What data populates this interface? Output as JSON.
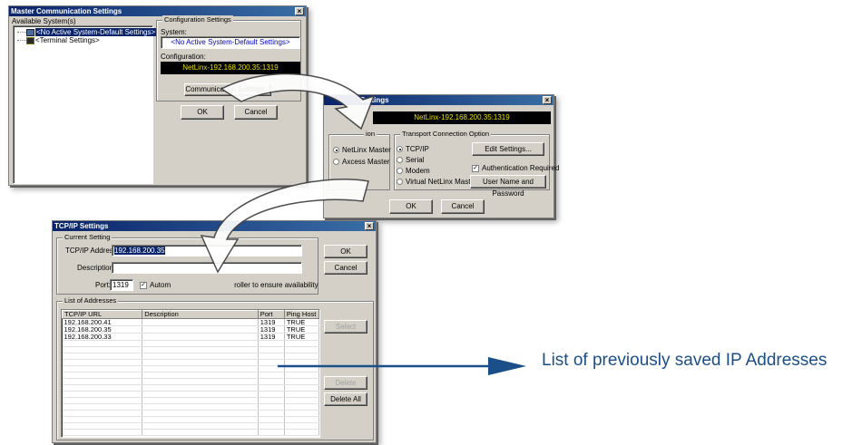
{
  "master_window": {
    "title": "Master Communication Settings",
    "available_label": "Available System(s)",
    "tree": [
      "<No Active System-Default Settings>",
      "<Terminal Settings>"
    ],
    "config_group": "Configuration Settings",
    "system_label": "System:",
    "system_value": "<No Active System-Default Settings>",
    "configuration_label": "Configuration:",
    "configuration_value": "NetLinx-192.168.200.35:1319",
    "comm_button": "Communication Settings...",
    "ok": "OK",
    "cancel": "Cancel"
  },
  "comm_window": {
    "title_fragment": "Settings",
    "configuration_value": "NetLinx-192.168.200.35:1319",
    "platform_group_fragment": "ion",
    "platform_options": [
      "NetLinx Master",
      "Axcess Master"
    ],
    "transport_group": "Transport Connection Option",
    "transport_options": [
      "TCP/IP",
      "Serial",
      "Modem",
      "Virtual NetLinx Master"
    ],
    "edit_settings": "Edit Settings...",
    "auth_required": "Authentication Required",
    "user_pass": "User Name and Password",
    "ok": "OK",
    "cancel": "Cancel"
  },
  "tcp_window": {
    "title": "TCP/IP Settings",
    "current_group": "Current Setting",
    "address_label": "TCP/IP Address:",
    "address_value": "192.168.200.35",
    "description_label": "Description:",
    "description_value": "",
    "port_label": "Port:",
    "port_value": "1319",
    "ping_left": "Autom",
    "ping_right": "roller to ensure availability",
    "ok": "OK",
    "cancel": "Cancel",
    "list_group": "List of Addresses",
    "columns": [
      "TCP/IP URL",
      "Description",
      "Port",
      "Ping Host"
    ],
    "rows": [
      [
        "192.168.200.41",
        "",
        "1319",
        "TRUE"
      ],
      [
        "192.168.200.35",
        "",
        "1319",
        "TRUE"
      ],
      [
        "192.168.200.33",
        "",
        "1319",
        "TRUE"
      ]
    ],
    "select": "Select",
    "delete": "Delete",
    "delete_all": "Delete All"
  },
  "callout": {
    "text": "List of previously saved IP Addresses",
    "color": "#1a4f8a"
  }
}
